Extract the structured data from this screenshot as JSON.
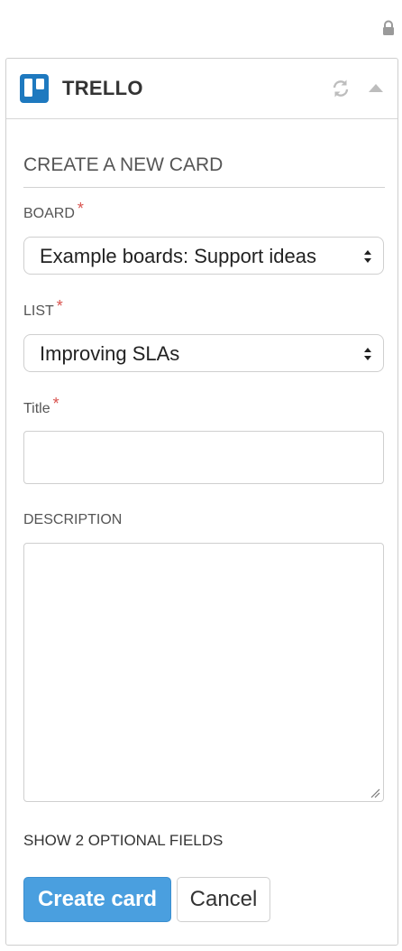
{
  "header": {
    "title": "TRELLO"
  },
  "form": {
    "section_title": "CREATE A NEW CARD",
    "required_mark": "*",
    "board": {
      "label": "BOARD",
      "value": "Example boards: Support ideas"
    },
    "list": {
      "label": "LIST",
      "value": "Improving SLAs"
    },
    "title": {
      "label": "Title",
      "value": ""
    },
    "description": {
      "label": "DESCRIPTION",
      "value": ""
    },
    "optional_fields_link": "SHOW 2 OPTIONAL FIELDS",
    "create_button": "Create card",
    "cancel_button": "Cancel"
  },
  "colors": {
    "accent": "#4a9fdf",
    "trello_blue": "#1e79bf",
    "required": "#d9534f"
  },
  "icons": [
    "lock-icon",
    "trello-logo-icon",
    "refresh-icon",
    "collapse-icon",
    "select-arrows-icon",
    "resize-handle-icon"
  ]
}
